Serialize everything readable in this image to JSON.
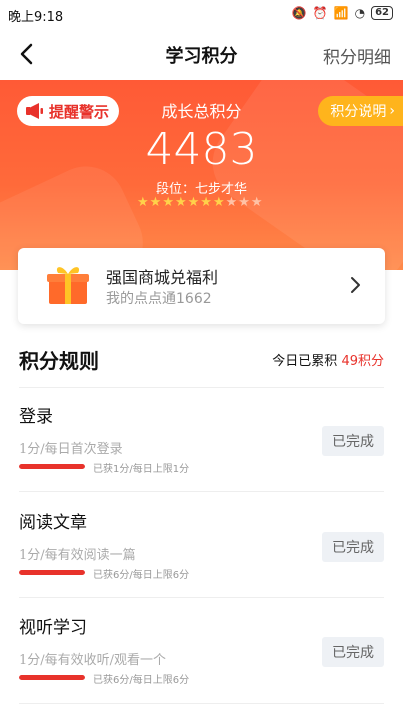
{
  "status": {
    "time": "晚上9:18",
    "battery": "62"
  },
  "nav": {
    "title": "学习积分",
    "detail": "积分明细"
  },
  "hero": {
    "warn_label": "提醒警示",
    "explain_label": "积分说明",
    "total_label": "成长总积分",
    "total_score": "4483",
    "rank": "段位：七步才华",
    "stars_filled": 7,
    "stars_total": 10,
    "star_color_on": "#ffd24a",
    "star_color_off": "#ffc2a6"
  },
  "mall": {
    "title": "强国商城兑福利",
    "subtitle": "我的点点通1662"
  },
  "rules": {
    "title": "积分规则",
    "today_prefix": "今日已累积",
    "today_points": "49积分",
    "items": [
      {
        "name": "登录",
        "desc": "1分/每日首次登录",
        "got": "已获1分/每日上限1分",
        "progress": 1.0,
        "button": "已完成"
      },
      {
        "name": "阅读文章",
        "desc": "1分/每有效阅读一篇",
        "got": "已获6分/每日上限6分",
        "progress": 1.0,
        "button": "已完成"
      },
      {
        "name": "视听学习",
        "desc": "1分/每有效收听/观看一个",
        "got": "已获6分/每日上限6分",
        "progress": 1.0,
        "button": "已完成"
      }
    ]
  },
  "colors": {
    "accent_red": "#e8322b",
    "hero_orange": "#ff6a3a",
    "explain_yellow": "#ffb41c"
  }
}
